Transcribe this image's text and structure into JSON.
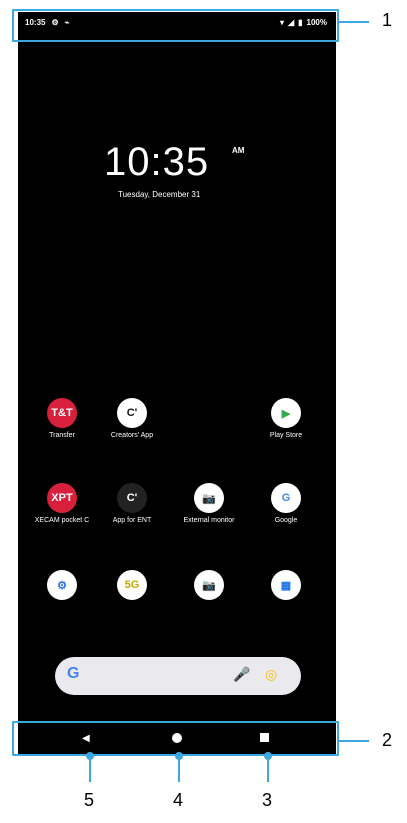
{
  "status": {
    "time": "10:35",
    "battery": "100%"
  },
  "lock": {
    "time": "10:35",
    "ampm": "AM",
    "date": "Tuesday, December 31"
  },
  "apps": [
    {
      "label": "Transfer",
      "icon": "T&T",
      "bg": "#d81f3c",
      "fg": "#fff"
    },
    {
      "label": "Creators' App",
      "icon": "C'",
      "bg": "#ffffff",
      "fg": "#111"
    },
    {
      "label": "Play Store",
      "icon": "▶",
      "bg": "#ffffff",
      "fg": "#34a853"
    },
    {
      "label": "XECAM pocket C",
      "icon": "XPT",
      "bg": "#d81f3c",
      "fg": "#fff"
    },
    {
      "label": "App for ENT",
      "icon": "C'",
      "bg": "#222",
      "fg": "#fff"
    },
    {
      "label": "External monitor",
      "icon": "📷",
      "bg": "#ffffff",
      "fg": "#111"
    },
    {
      "label": "Google",
      "icon": "G",
      "bg": "#ffffff",
      "fg": "#4285f4"
    },
    {
      "label": "",
      "icon": "⚙",
      "bg": "#ffffff",
      "fg": "#2a73e8"
    },
    {
      "label": "",
      "icon": "5G",
      "bg": "#ffffff",
      "fg": "#c6a600"
    },
    {
      "label": "",
      "icon": "📷",
      "bg": "#ffffff",
      "fg": "#1a73e8"
    },
    {
      "label": "",
      "icon": "▦",
      "bg": "#ffffff",
      "fg": "#1a73e8"
    }
  ],
  "callouts": {
    "n1": "1",
    "n2": "2",
    "n3": "3",
    "n4": "4",
    "n5": "5"
  },
  "colors": {
    "highlight": "#3fa7e0"
  }
}
